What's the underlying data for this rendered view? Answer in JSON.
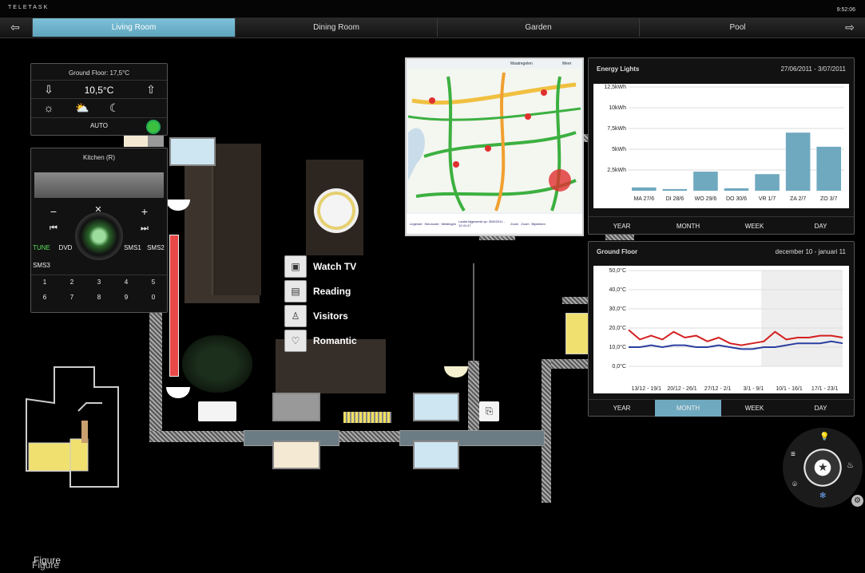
{
  "header": {
    "brand": "TELETASK",
    "time": "9:52:06"
  },
  "rooms": [
    "Living Room",
    "Dining Room",
    "Garden",
    "Pool"
  ],
  "climate": {
    "title": "Ground Floor: 17,5°C",
    "setpoint": "10,5°C",
    "mode": "AUTO"
  },
  "audio": {
    "title": "Kitchen (R)",
    "sources": [
      "TUNE",
      "DVD",
      "SMS1",
      "SMS2",
      "SMS3"
    ],
    "keys": [
      "1",
      "2",
      "3",
      "4",
      "5",
      "6",
      "7",
      "8",
      "9",
      "0"
    ]
  },
  "scenes": [
    "Watch TV",
    "Reading",
    "Visitors",
    "Romantic"
  ],
  "map": {
    "top_left": "Maatregelen",
    "top_right": "Meer",
    "bottom": [
      "Legende",
      "Kleurcode",
      "Meldingen",
      "Laatst bijgewerkt op: 30/6/2011 - 12:41:47",
      "Zoom",
      "Zoom",
      "Bijwerken"
    ]
  },
  "energy": {
    "title": "Energy Lights",
    "range": "27/06/2011 - 3/07/2011",
    "tabs": [
      "YEAR",
      "MONTH",
      "WEEK",
      "DAY"
    ],
    "active_tab": "MONTH"
  },
  "temp": {
    "title": "Ground Floor",
    "range": "december 10 - januari 11",
    "tabs": [
      "YEAR",
      "MONTH",
      "WEEK",
      "DAY"
    ],
    "active_tab": "MONTH"
  },
  "chart_data": [
    {
      "type": "bar",
      "title": "Energy Lights",
      "categories": [
        "MA 27/6",
        "DI 28/6",
        "WO 29/6",
        "DO 30/6",
        "VR 1/7",
        "ZA 2/7",
        "ZO 3/7"
      ],
      "yticks": [
        "12,5kWh",
        "10kWh",
        "7,5kWh",
        "5kWh",
        "2,5kWh"
      ],
      "ylim": [
        0,
        12.5
      ],
      "values": [
        0.4,
        0.2,
        2.3,
        0.3,
        2.0,
        7.0,
        5.3
      ],
      "color": "#6fa9bf"
    },
    {
      "type": "line",
      "title": "Ground Floor",
      "categories": [
        "13/12 - 19/1",
        "20/12 - 26/1",
        "27/12 - 2/1",
        "3/1 - 9/1",
        "10/1 - 16/1",
        "17/1 - 23/1"
      ],
      "yticks": [
        "50,0°C",
        "40,0°C",
        "30,0°C",
        "20,0°C",
        "10,0°C",
        "0,0°C"
      ],
      "ylim": [
        0,
        50
      ],
      "series": [
        {
          "color": "#d42020",
          "values": [
            19,
            14,
            16,
            14,
            18,
            15,
            16,
            13,
            15,
            12,
            11,
            12,
            13,
            18,
            14,
            15,
            15,
            16,
            16,
            15
          ]
        },
        {
          "color": "#2a3fa0",
          "values": [
            10,
            10,
            11,
            10,
            11,
            11,
            10,
            10,
            11,
            10,
            9,
            9,
            10,
            10,
            11,
            12,
            12,
            12,
            13,
            12
          ]
        }
      ]
    }
  ],
  "footer": {
    "label": "Figure"
  }
}
